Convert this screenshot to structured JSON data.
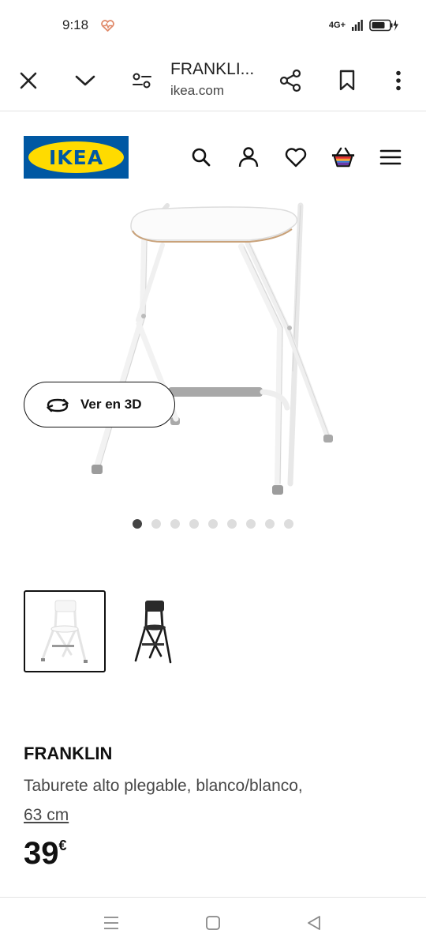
{
  "status": {
    "time": "9:18",
    "network": "4G+"
  },
  "browser": {
    "title": "FRANKLI...",
    "url": "ikea.com"
  },
  "ikea": {
    "logo_text": "IKEA"
  },
  "gallery": {
    "view3d_label": "Ver en 3D",
    "dot_count": 9,
    "active_dot": 0
  },
  "product": {
    "name": "FRANKLIN",
    "description": "Taburete alto plegable, blanco/blanco,",
    "size": "63 cm",
    "price": "39",
    "currency": "€"
  },
  "colors": {
    "ikea_blue": "#0058a3",
    "ikea_yellow": "#ffdb00"
  }
}
